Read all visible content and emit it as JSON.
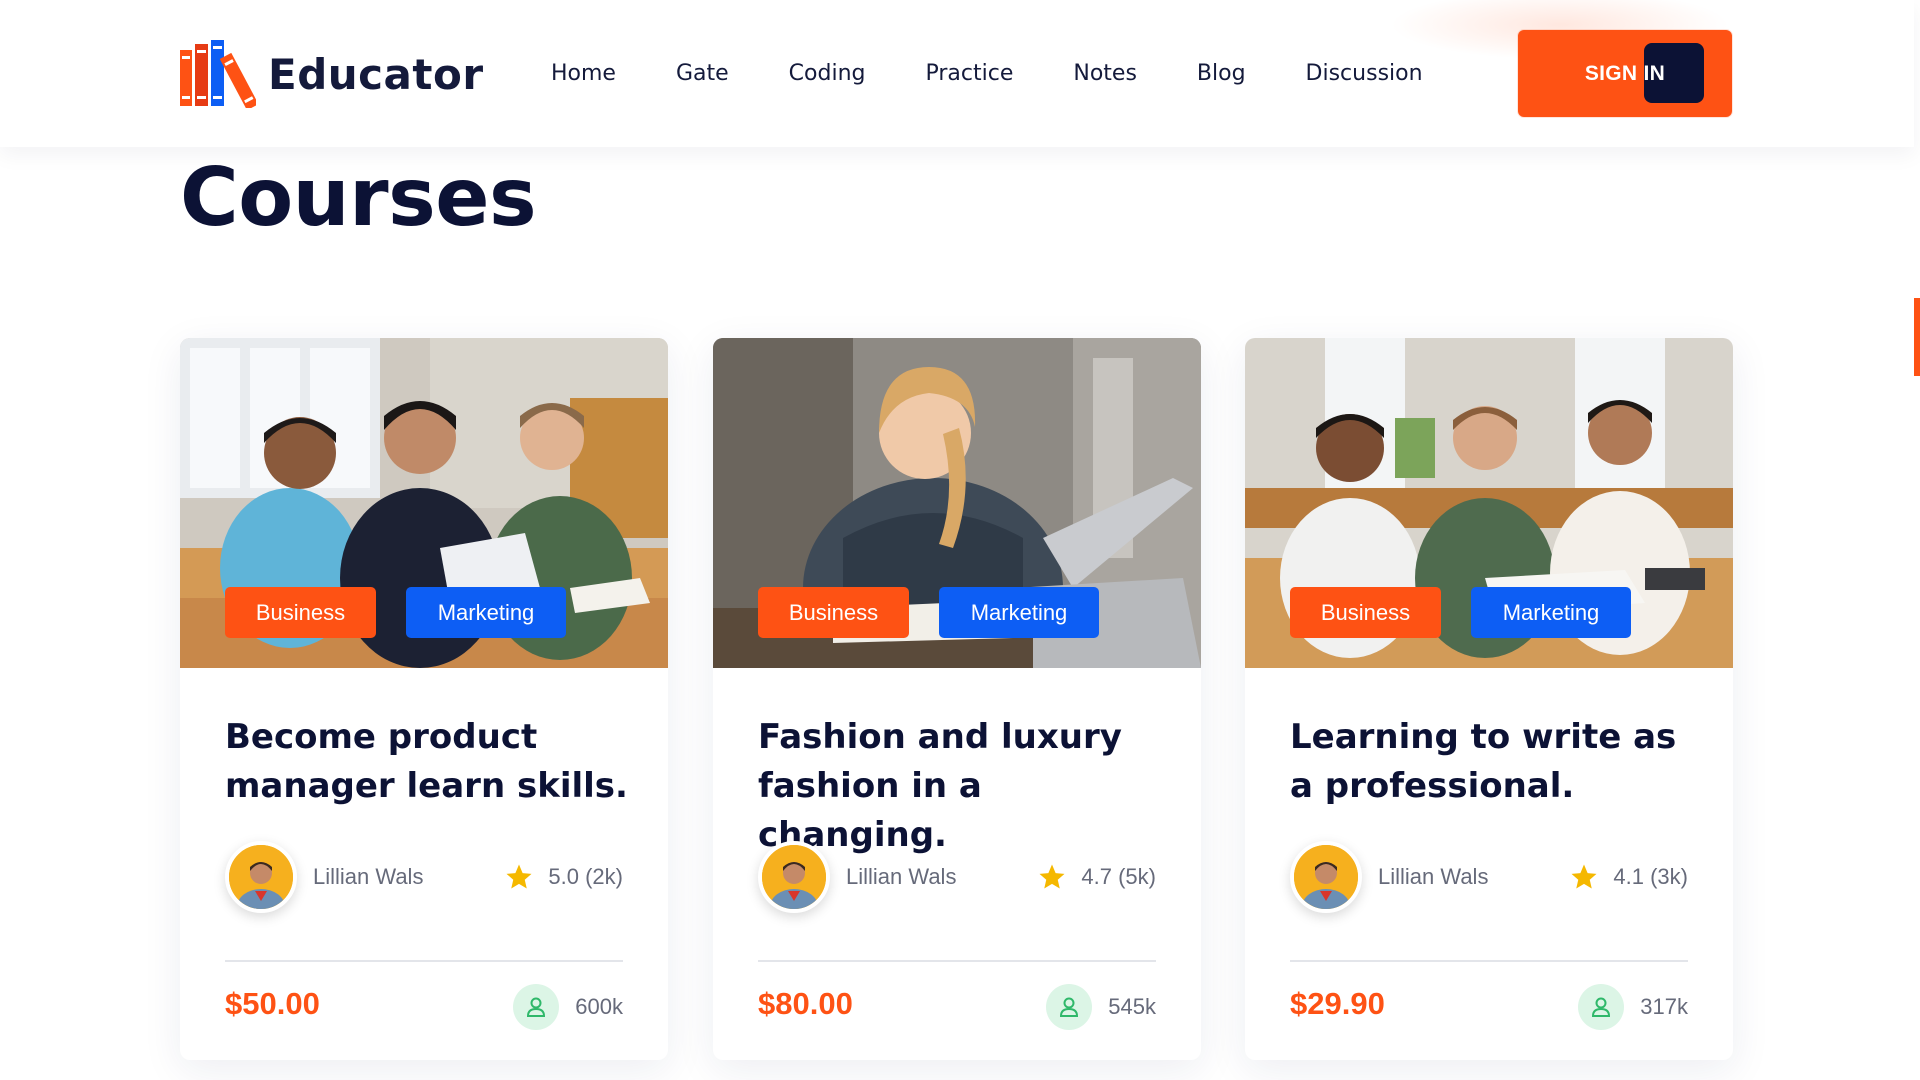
{
  "brand": {
    "name": "Educator"
  },
  "nav": {
    "items": [
      "Home",
      "Gate",
      "Coding",
      "Practice",
      "Notes",
      "Blog",
      "Discussion"
    ],
    "sign_in_label": "SIGN IN"
  },
  "page": {
    "title": "Courses"
  },
  "colors": {
    "accent": "#fe5214",
    "tag_blue": "#0d5ef4",
    "navy": "#0c1235",
    "icon_green_bg": "#dcf5e6"
  },
  "courses": [
    {
      "tags": [
        "Business",
        "Marketing"
      ],
      "title": "Become product manager learn skills.",
      "author": "Lillian Wals",
      "rating": "5.0 (2k)",
      "price": "$50.00",
      "students": "600k"
    },
    {
      "tags": [
        "Business",
        "Marketing"
      ],
      "title": "Fashion and luxury fashion in a changing.",
      "author": "Lillian Wals",
      "rating": "4.7 (5k)",
      "price": "$80.00",
      "students": "545k"
    },
    {
      "tags": [
        "Business",
        "Marketing"
      ],
      "title": "Learning to write as a professional.",
      "author": "Lillian Wals",
      "rating": "4.1 (3k)",
      "price": "$29.90",
      "students": "317k"
    }
  ]
}
